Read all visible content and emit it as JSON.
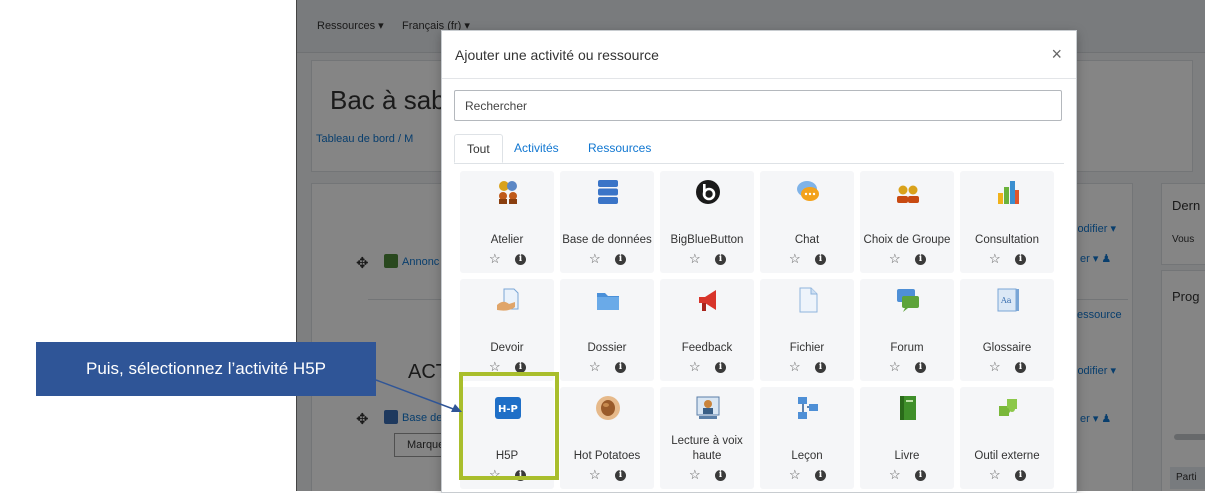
{
  "background": {
    "topbar_items": [
      "Ressources ▾",
      "Français (fr) ▾"
    ],
    "course_title": "Bac à sab",
    "breadcrumb": "Tableau de bord / M",
    "row1_label": "Annonc",
    "section_label": "ACTI",
    "row2_label": "Base de",
    "mark_button": "Marquer c",
    "right_labels": [
      "lodifier ▾",
      "er ▾ ♟",
      "essource",
      "lodifier ▾",
      "er ▾ ♟"
    ],
    "far_right": [
      "Dern",
      "Vous",
      "Prog",
      "Parti"
    ]
  },
  "modal": {
    "title": "Ajouter une activité ou ressource",
    "close_glyph": "×",
    "search_placeholder": "Rechercher",
    "tabs": [
      "Tout",
      "Activités",
      "Ressources"
    ],
    "tiles": [
      {
        "label": "Atelier",
        "icon": "workshop-icon"
      },
      {
        "label": "Base de données",
        "icon": "database-icon"
      },
      {
        "label": "BigBlueButton",
        "icon": "bigbluebutton-icon"
      },
      {
        "label": "Chat",
        "icon": "chat-icon"
      },
      {
        "label": "Choix de Groupe",
        "icon": "group-choice-icon"
      },
      {
        "label": "Consultation",
        "icon": "feedback-chart-icon"
      },
      {
        "label": "Devoir",
        "icon": "assignment-icon"
      },
      {
        "label": "Dossier",
        "icon": "folder-icon"
      },
      {
        "label": "Feedback",
        "icon": "megaphone-icon"
      },
      {
        "label": "Fichier",
        "icon": "file-icon"
      },
      {
        "label": "Forum",
        "icon": "forum-icon"
      },
      {
        "label": "Glossaire",
        "icon": "glossary-icon"
      },
      {
        "label": "H5P",
        "icon": "h5p-icon"
      },
      {
        "label": "Hot Potatoes",
        "icon": "hot-potatoes-icon"
      },
      {
        "label": "Lecture à voix haute",
        "icon": "read-aloud-icon"
      },
      {
        "label": "Leçon",
        "icon": "lesson-icon"
      },
      {
        "label": "Livre",
        "icon": "book-icon"
      },
      {
        "label": "Outil externe",
        "icon": "puzzle-icon"
      }
    ]
  },
  "callout": {
    "text": "Puis, sélectionnez l’activité H5P"
  },
  "colors": {
    "callout_bg": "#2f5597",
    "highlight": "#a9be2c",
    "link": "#1177d1"
  }
}
